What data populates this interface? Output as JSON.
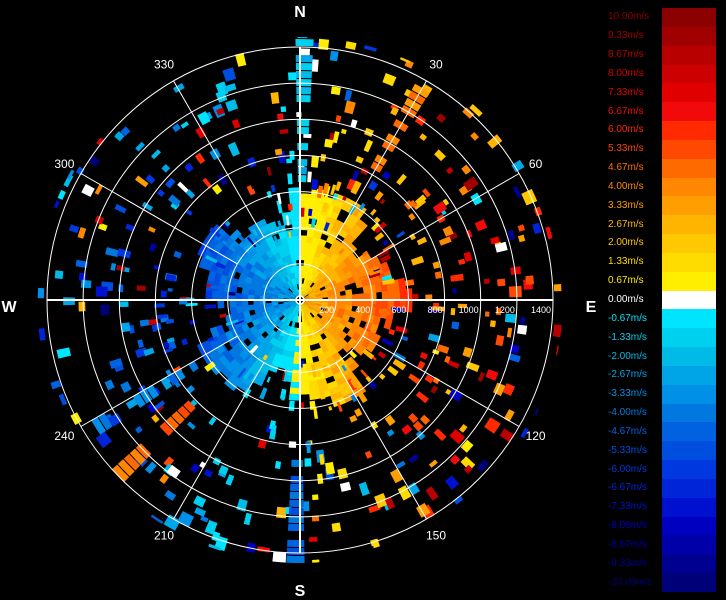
{
  "chart_data": {
    "type": "polar-radar",
    "direction_labels": {
      "north": "N",
      "east": "E",
      "south": "S",
      "west": "W"
    },
    "azimuth_labels": [
      "30",
      "60",
      "120",
      "150",
      "210",
      "240",
      "300",
      "330"
    ],
    "range_labels": [
      "200",
      "400",
      "600",
      "800",
      "1000",
      "1200",
      "1400"
    ],
    "grid": true,
    "rings": 7,
    "legend": {
      "position": "right",
      "levels": [
        {
          "label": "10.00m/s",
          "color": "#8b0000"
        },
        {
          "label": "9.33m/s",
          "color": "#a00000"
        },
        {
          "label": "8.67m/s",
          "color": "#b80000"
        },
        {
          "label": "8.00m/s",
          "color": "#cc0000"
        },
        {
          "label": "7.33m/s",
          "color": "#e00000"
        },
        {
          "label": "6.67m/s",
          "color": "#f20a0a"
        },
        {
          "label": "6.00m/s",
          "color": "#ff2a00"
        },
        {
          "label": "5.33m/s",
          "color": "#ff4800"
        },
        {
          "label": "4.67m/s",
          "color": "#ff6a00"
        },
        {
          "label": "4.00m/s",
          "color": "#ff8800"
        },
        {
          "label": "3.33m/s",
          "color": "#ff9e00"
        },
        {
          "label": "2.67m/s",
          "color": "#ffb400"
        },
        {
          "label": "2.00m/s",
          "color": "#ffc800"
        },
        {
          "label": "1.33m/s",
          "color": "#ffdc00"
        },
        {
          "label": "0.67m/s",
          "color": "#ffee00"
        },
        {
          "label": "0.00m/s",
          "color": "#ffffff"
        },
        {
          "label": "-0.67m/s",
          "color": "#00e5ff"
        },
        {
          "label": "-1.33m/s",
          "color": "#00d0f0"
        },
        {
          "label": "-2.00m/s",
          "color": "#00bbe8"
        },
        {
          "label": "-2.67m/s",
          "color": "#00a5e8"
        },
        {
          "label": "-3.33m/s",
          "color": "#0090e8"
        },
        {
          "label": "-4.00m/s",
          "color": "#0078e0"
        },
        {
          "label": "-4.67m/s",
          "color": "#0062e0"
        },
        {
          "label": "-5.33m/s",
          "color": "#004ee0"
        },
        {
          "label": "-6.00m/s",
          "color": "#0038e0"
        },
        {
          "label": "-6.67m/s",
          "color": "#0024d8"
        },
        {
          "label": "-7.33m/s",
          "color": "#0010d0"
        },
        {
          "label": "-8.00m/s",
          "color": "#0000c0"
        },
        {
          "label": "-8.67m/s",
          "color": "#0000a8"
        },
        {
          "label": "-9.33m/s",
          "color": "#000090"
        },
        {
          "label": "-10.00m/s",
          "color": "#000078"
        }
      ]
    }
  }
}
